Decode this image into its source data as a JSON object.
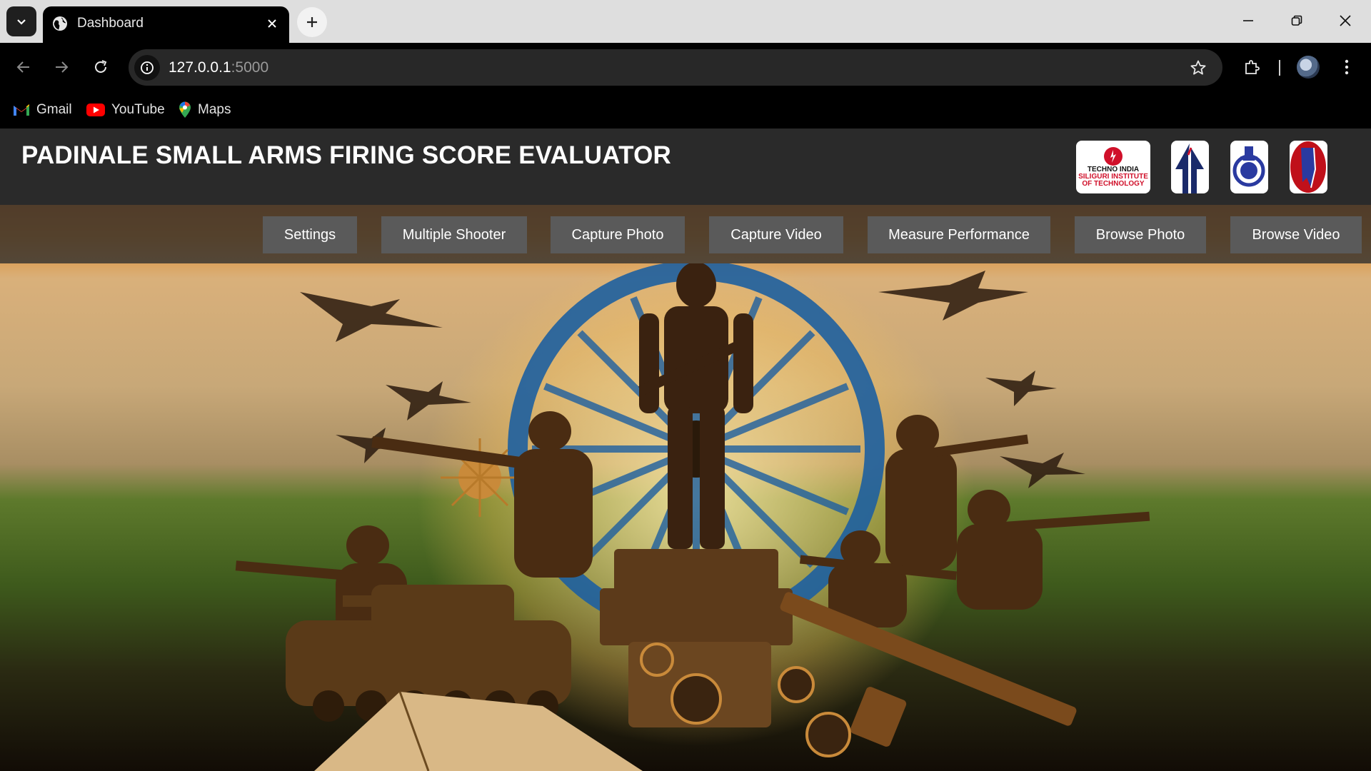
{
  "browser": {
    "tab": {
      "title": "Dashboard"
    },
    "address": {
      "host": "127.0.0.1",
      "port": ":5000"
    },
    "bookmarks": [
      {
        "label": "Gmail",
        "icon": "gmail-icon"
      },
      {
        "label": "YouTube",
        "icon": "youtube-icon"
      },
      {
        "label": "Maps",
        "icon": "maps-icon"
      }
    ]
  },
  "site": {
    "title": "PADINALE SMALL ARMS FIRING SCORE EVALUATOR",
    "logos": [
      {
        "name": "techno-india-logo",
        "text_lines": [
          "TECHNO INDIA",
          "SILIGURI INSTITUTE",
          "OF TECHNOLOGY"
        ]
      },
      {
        "name": "arrow-emblem-logo"
      },
      {
        "name": "police-emblem-logo"
      },
      {
        "name": "red-shield-logo"
      }
    ],
    "nav": [
      {
        "label": "Settings"
      },
      {
        "label": "Multiple Shooter"
      },
      {
        "label": "Capture Photo"
      },
      {
        "label": "Capture Video"
      },
      {
        "label": "Measure Performance"
      },
      {
        "label": "Browse Photo"
      },
      {
        "label": "Browse Video"
      }
    ]
  },
  "colors": {
    "header_bg": "#2a2a2a",
    "button_bg": "#5a5a5a",
    "saffron": "#e08a2a",
    "green": "#3e5a1c",
    "chakra_blue": "#1d5fa0"
  }
}
